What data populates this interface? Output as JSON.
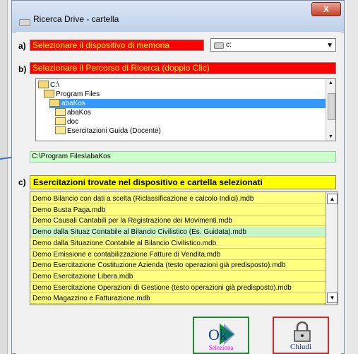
{
  "window": {
    "title": "Ricerca Drive - cartella",
    "close_glyph": "X"
  },
  "step_a": {
    "letter": "a)",
    "label": "Selezionare il dispositivo di memoria",
    "drive_value": "c:"
  },
  "step_b": {
    "letter": "b)",
    "label": "Selezionare il Percorso di Ricerca (doppio Clic)",
    "tree": [
      {
        "label": "C:\\",
        "state": "open"
      },
      {
        "label": "Program Files",
        "state": "open"
      },
      {
        "label": "abaKos",
        "state": "selected"
      },
      {
        "label": "abaKos",
        "state": "closed"
      },
      {
        "label": "doc",
        "state": "closed"
      },
      {
        "label": "Esercitazioni Guida (Docente)",
        "state": "closed"
      }
    ],
    "path": "C:\\Program Files\\abaKos"
  },
  "step_c": {
    "letter": "c)",
    "label": "Esercitazioni trovate nel dispositivo e cartella selezionati",
    "files": [
      "Demo Bilancio con dati a scelta (Riclassificazione e calcolo Indici).mdb",
      "Demo Busta Paga.mdb",
      "Demo Causali Cantabili per la Registrazione dei Movimenti.mdb",
      "Demo dalla Situaz Contabile al Bilancio Civilistico (Es. Guidata).mdb",
      "Demo dalla Situazione Contabile al Bilancio Civilistico.mdb",
      "Demo Emissione e contabilizzazione Fatture di Vendita.mdb",
      "Demo Esercitazione Costituzione Azienda (testo operazioni già predisposto).mdb",
      "Demo Esercitazione Libera.mdb",
      "Demo Esercitazione Operazioni di Gestione (testo operazioni già predisposto).mdb",
      "Demo Magazzino e Fatturazione.mdb"
    ],
    "highlighted_index": 3
  },
  "buttons": {
    "select_top": "Ok",
    "select_caption": "Seleziona",
    "close_caption": "Chiudi"
  },
  "colors": {
    "red_label_bg": "#ff0000",
    "red_label_text": "#ffff00",
    "path_bg": "#ccffcc",
    "list_bg": "#ffff80",
    "header_yellow": "#ffff00",
    "selection_blue": "#3399ff"
  }
}
